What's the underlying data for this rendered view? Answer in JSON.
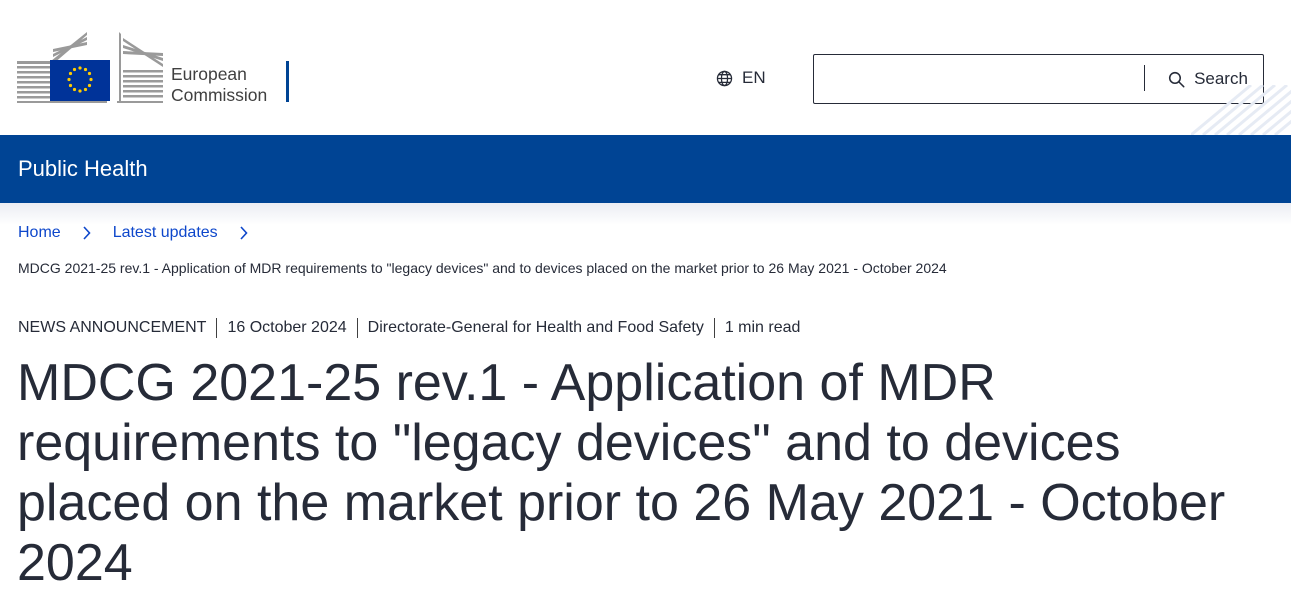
{
  "header": {
    "logo_line1": "European",
    "logo_line2": "Commission",
    "language": "EN",
    "search_placeholder": "",
    "search_label": "Search"
  },
  "site": {
    "name": "Public Health"
  },
  "breadcrumb": {
    "items": [
      "Home",
      "Latest updates"
    ],
    "current": "MDCG 2021-25 rev.1 - Application of MDR requirements to \"legacy devices\" and to devices placed on the market prior to 26 May 2021 - October 2024"
  },
  "meta": {
    "type": "NEWS ANNOUNCEMENT",
    "date": "16 October 2024",
    "author": "Directorate-General for Health and Food Safety",
    "read_time": "1 min read"
  },
  "page": {
    "title": "MDCG 2021-25 rev.1 - Application of MDR requirements to \"legacy devices\" and to devices placed on the market prior to 26 May 2021 - October 2024"
  },
  "colors": {
    "brand_blue": "#004494",
    "link_blue": "#0e47cb",
    "eu_flag_blue": "#003399",
    "eu_star_yellow": "#ffcc00",
    "text_dark": "#262b38"
  },
  "icons": {
    "language": "globe-icon",
    "search": "search-icon",
    "breadcrumb_separator": "chevron-right-icon"
  }
}
